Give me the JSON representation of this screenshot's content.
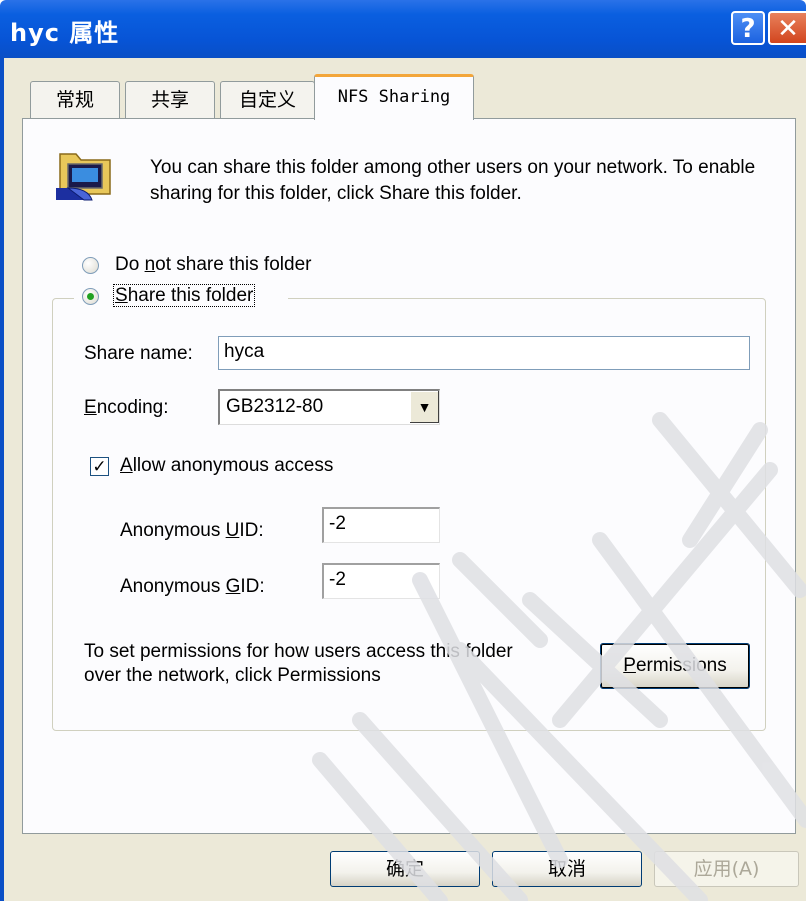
{
  "window": {
    "title": "hyc 属性",
    "help_glyph": "?",
    "close_glyph": "✕"
  },
  "tabs": [
    {
      "label": "常规"
    },
    {
      "label": "共享"
    },
    {
      "label": "自定义"
    },
    {
      "label": "NFS Sharing"
    }
  ],
  "intro_text": "You can share this folder among other users on your network. To enable sharing for this folder, click Share this folder.",
  "radios": {
    "not_share": {
      "prefix": "Do ",
      "mnemonic": "n",
      "suffix": "ot share this folder",
      "selected": false
    },
    "share": {
      "prefix": "",
      "mnemonic": "S",
      "suffix": "hare this folder",
      "selected": true
    }
  },
  "share_name": {
    "label": "Share name:",
    "value": "hyca"
  },
  "encoding": {
    "mnemonic": "E",
    "label_rest": "ncoding:",
    "value": "GB2312-80"
  },
  "anonymous": {
    "checked": true,
    "mnemonic": "A",
    "label_rest": "llow anonymous access",
    "uid_prefix": "Anonymous ",
    "uid_mnemonic": "U",
    "uid_suffix": "ID:",
    "uid_value": "-2",
    "gid_prefix": "Anonymous ",
    "gid_mnemonic": "G",
    "gid_suffix": "ID:",
    "gid_value": "-2"
  },
  "permissions": {
    "text_line1": "To set permissions for how users access this folder",
    "text_line2": "over the network, click Permissions",
    "button_mnemonic": "P",
    "button_rest": "ermissions"
  },
  "buttons": {
    "ok": "确定",
    "cancel": "取消",
    "apply": "应用(A)"
  },
  "colors": {
    "titlebar": "#0a5fe0",
    "dialog_bg": "#ece9d8",
    "active_tab_accent": "#f3a63a",
    "radio_dot": "#21a121"
  }
}
